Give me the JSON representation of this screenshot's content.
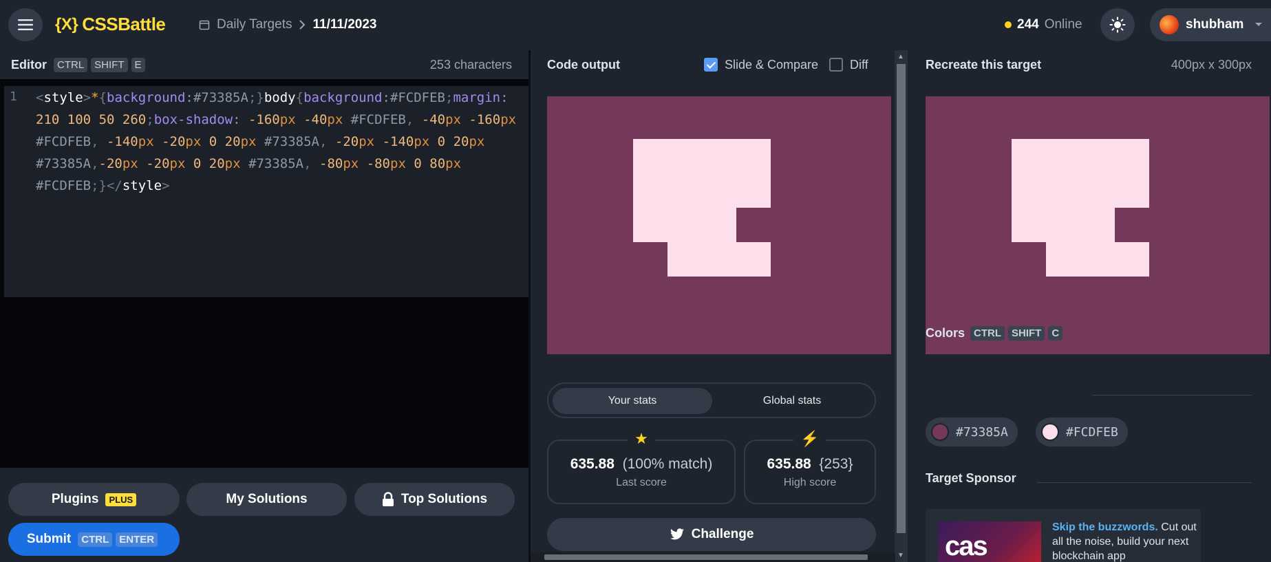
{
  "header": {
    "logo_mark": "{X}",
    "logo_text": "CSSBattle",
    "breadcrumb": "Daily Targets",
    "date": "11/11/2023",
    "online_count": "244",
    "online_label": "Online",
    "username": "shubham"
  },
  "editor": {
    "title": "Editor",
    "shortcut": [
      "CTRL",
      "SHIFT",
      "E"
    ],
    "char_count": "253 characters",
    "line_number": "1",
    "code": "<style>*{background:#73385A;}body{background:#FCDFEB;margin: 210 100 50 260;box-shadow: -160px -40px #FCDFEB, -40px -160px #FCDFEB, -140px -20px 0 20px #73385A, -20px -140px 0 20px #73385A,-20px -20px 0 20px #73385A, -80px -80px 0 80px #FCDFEB;}</style>"
  },
  "buttons": {
    "plugins": "Plugins",
    "plugins_badge": "PLUS",
    "my_solutions": "My Solutions",
    "top_solutions": "Top Solutions",
    "submit": "Submit",
    "submit_kbd": [
      "CTRL",
      "ENTER"
    ]
  },
  "output": {
    "title": "Code output",
    "slide_compare": "Slide & Compare",
    "slide_compare_checked": true,
    "diff": "Diff",
    "diff_checked": false
  },
  "stats": {
    "tab_your": "Your stats",
    "tab_global": "Global stats",
    "last_score": "635.88",
    "last_match": "(100% match)",
    "last_label": "Last score",
    "high_score": "635.88",
    "high_chars": "{253}",
    "high_label": "High score",
    "challenge": "Challenge"
  },
  "target": {
    "title": "Recreate this target",
    "size": "400px x 300px",
    "colors_title": "Colors",
    "colors_kbd": [
      "CTRL",
      "SHIFT",
      "C"
    ],
    "colors": [
      {
        "hex": "#73385A",
        "value": "#73385A"
      },
      {
        "hex": "#FCDFEB",
        "value": "#FCDFEB"
      }
    ],
    "sponsor_title": "Target Sponsor",
    "sponsor_logo": "cas",
    "sponsor_headline": "Skip the buzzwords.",
    "sponsor_body": "Cut out all the noise, build your next blockchain app"
  }
}
